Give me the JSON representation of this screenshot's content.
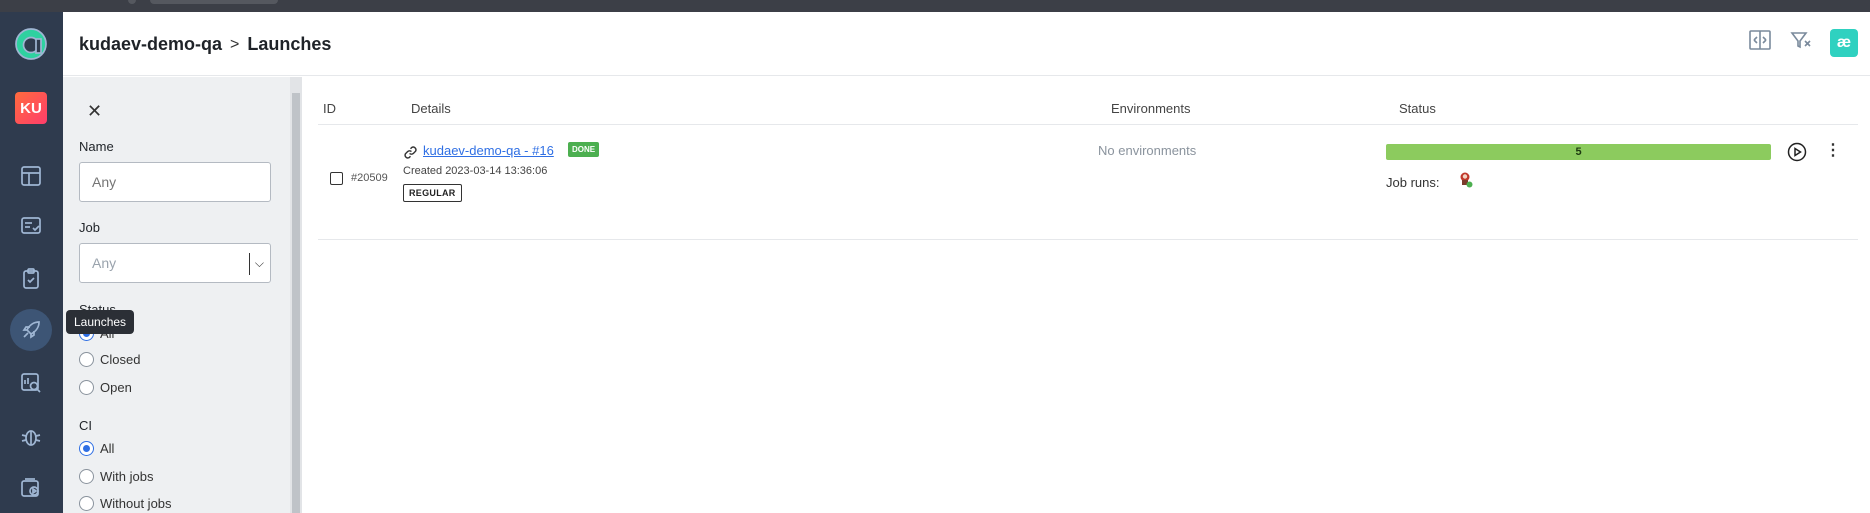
{
  "colors": {
    "rail_bg": "#2f3b4e",
    "accent": "#2f6fe4",
    "success": "#4caf50",
    "progress_fill": "#8ccb5e",
    "brand": "#2fd1c0"
  },
  "rail": {
    "avatar_initials": "KU",
    "icons": [
      "app-logo-icon",
      "dashboard-icon",
      "test-cases-icon",
      "test-plans-icon",
      "launches-icon",
      "analytics-icon",
      "defects-icon",
      "jobs-icon"
    ],
    "tooltip": "Launches"
  },
  "header": {
    "project": "kudaev-demo-qa",
    "separator": ">",
    "page_title": "Launches",
    "brand_glyph": "æ"
  },
  "filters": {
    "name_label": "Name",
    "name_placeholder": "Any",
    "job_label": "Job",
    "job_placeholder": "Any",
    "status_label": "Status",
    "status_options": [
      {
        "label": "All",
        "selected": true
      },
      {
        "label": "Closed",
        "selected": false
      },
      {
        "label": "Open",
        "selected": false
      }
    ],
    "ci_label": "CI",
    "ci_options": [
      {
        "label": "All",
        "selected": true
      },
      {
        "label": "With jobs",
        "selected": false
      },
      {
        "label": "Without jobs",
        "selected": false
      }
    ]
  },
  "table": {
    "headers": {
      "id": "ID",
      "details": "Details",
      "environments": "Environments",
      "status": "Status"
    },
    "rows": [
      {
        "id": "#20509",
        "name": "kudaev-demo-qa - #16",
        "state_badge": "DONE",
        "created": "Created 2023-03-14 13:36:06",
        "type": "REGULAR",
        "environments": "No environments",
        "status_count": "5",
        "job_runs_label": "Job runs:"
      }
    ]
  }
}
